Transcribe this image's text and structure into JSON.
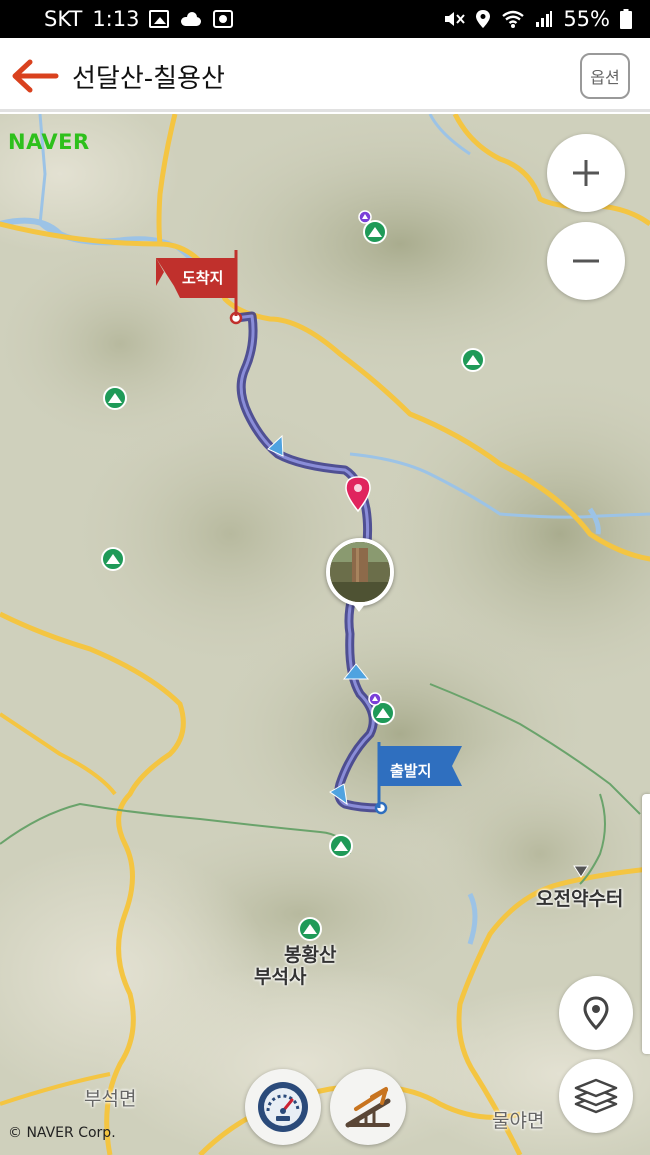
{
  "status_bar": {
    "carrier": "SKT",
    "time": "1:13",
    "battery": "55%"
  },
  "header": {
    "title": "선달산-칠용산",
    "options_label": "옵션"
  },
  "map": {
    "logo": "NAVER",
    "copyright": "© NAVER Corp.",
    "arrival_label": "도착지",
    "departure_label": "출발지",
    "places": [
      {
        "name": "오전약수터"
      },
      {
        "name": "봉황산"
      },
      {
        "name": "부석사"
      },
      {
        "name": "부석면"
      },
      {
        "name": "물야면"
      }
    ],
    "icons": {
      "zoom_in": "plus-icon",
      "zoom_out": "minus-icon",
      "location": "location-pin-icon",
      "layers": "layers-icon",
      "speedometer": "speedometer-icon",
      "elevation": "elevation-profile-icon"
    },
    "colors": {
      "route": "#3a3a8c",
      "road": "#f4c542",
      "river": "#9cc3e6",
      "mountain_marker": "#1f9a58",
      "arrival_flag": "#c0302c",
      "departure_flag": "#2f6fbf",
      "current_pin": "#e0245e"
    }
  }
}
